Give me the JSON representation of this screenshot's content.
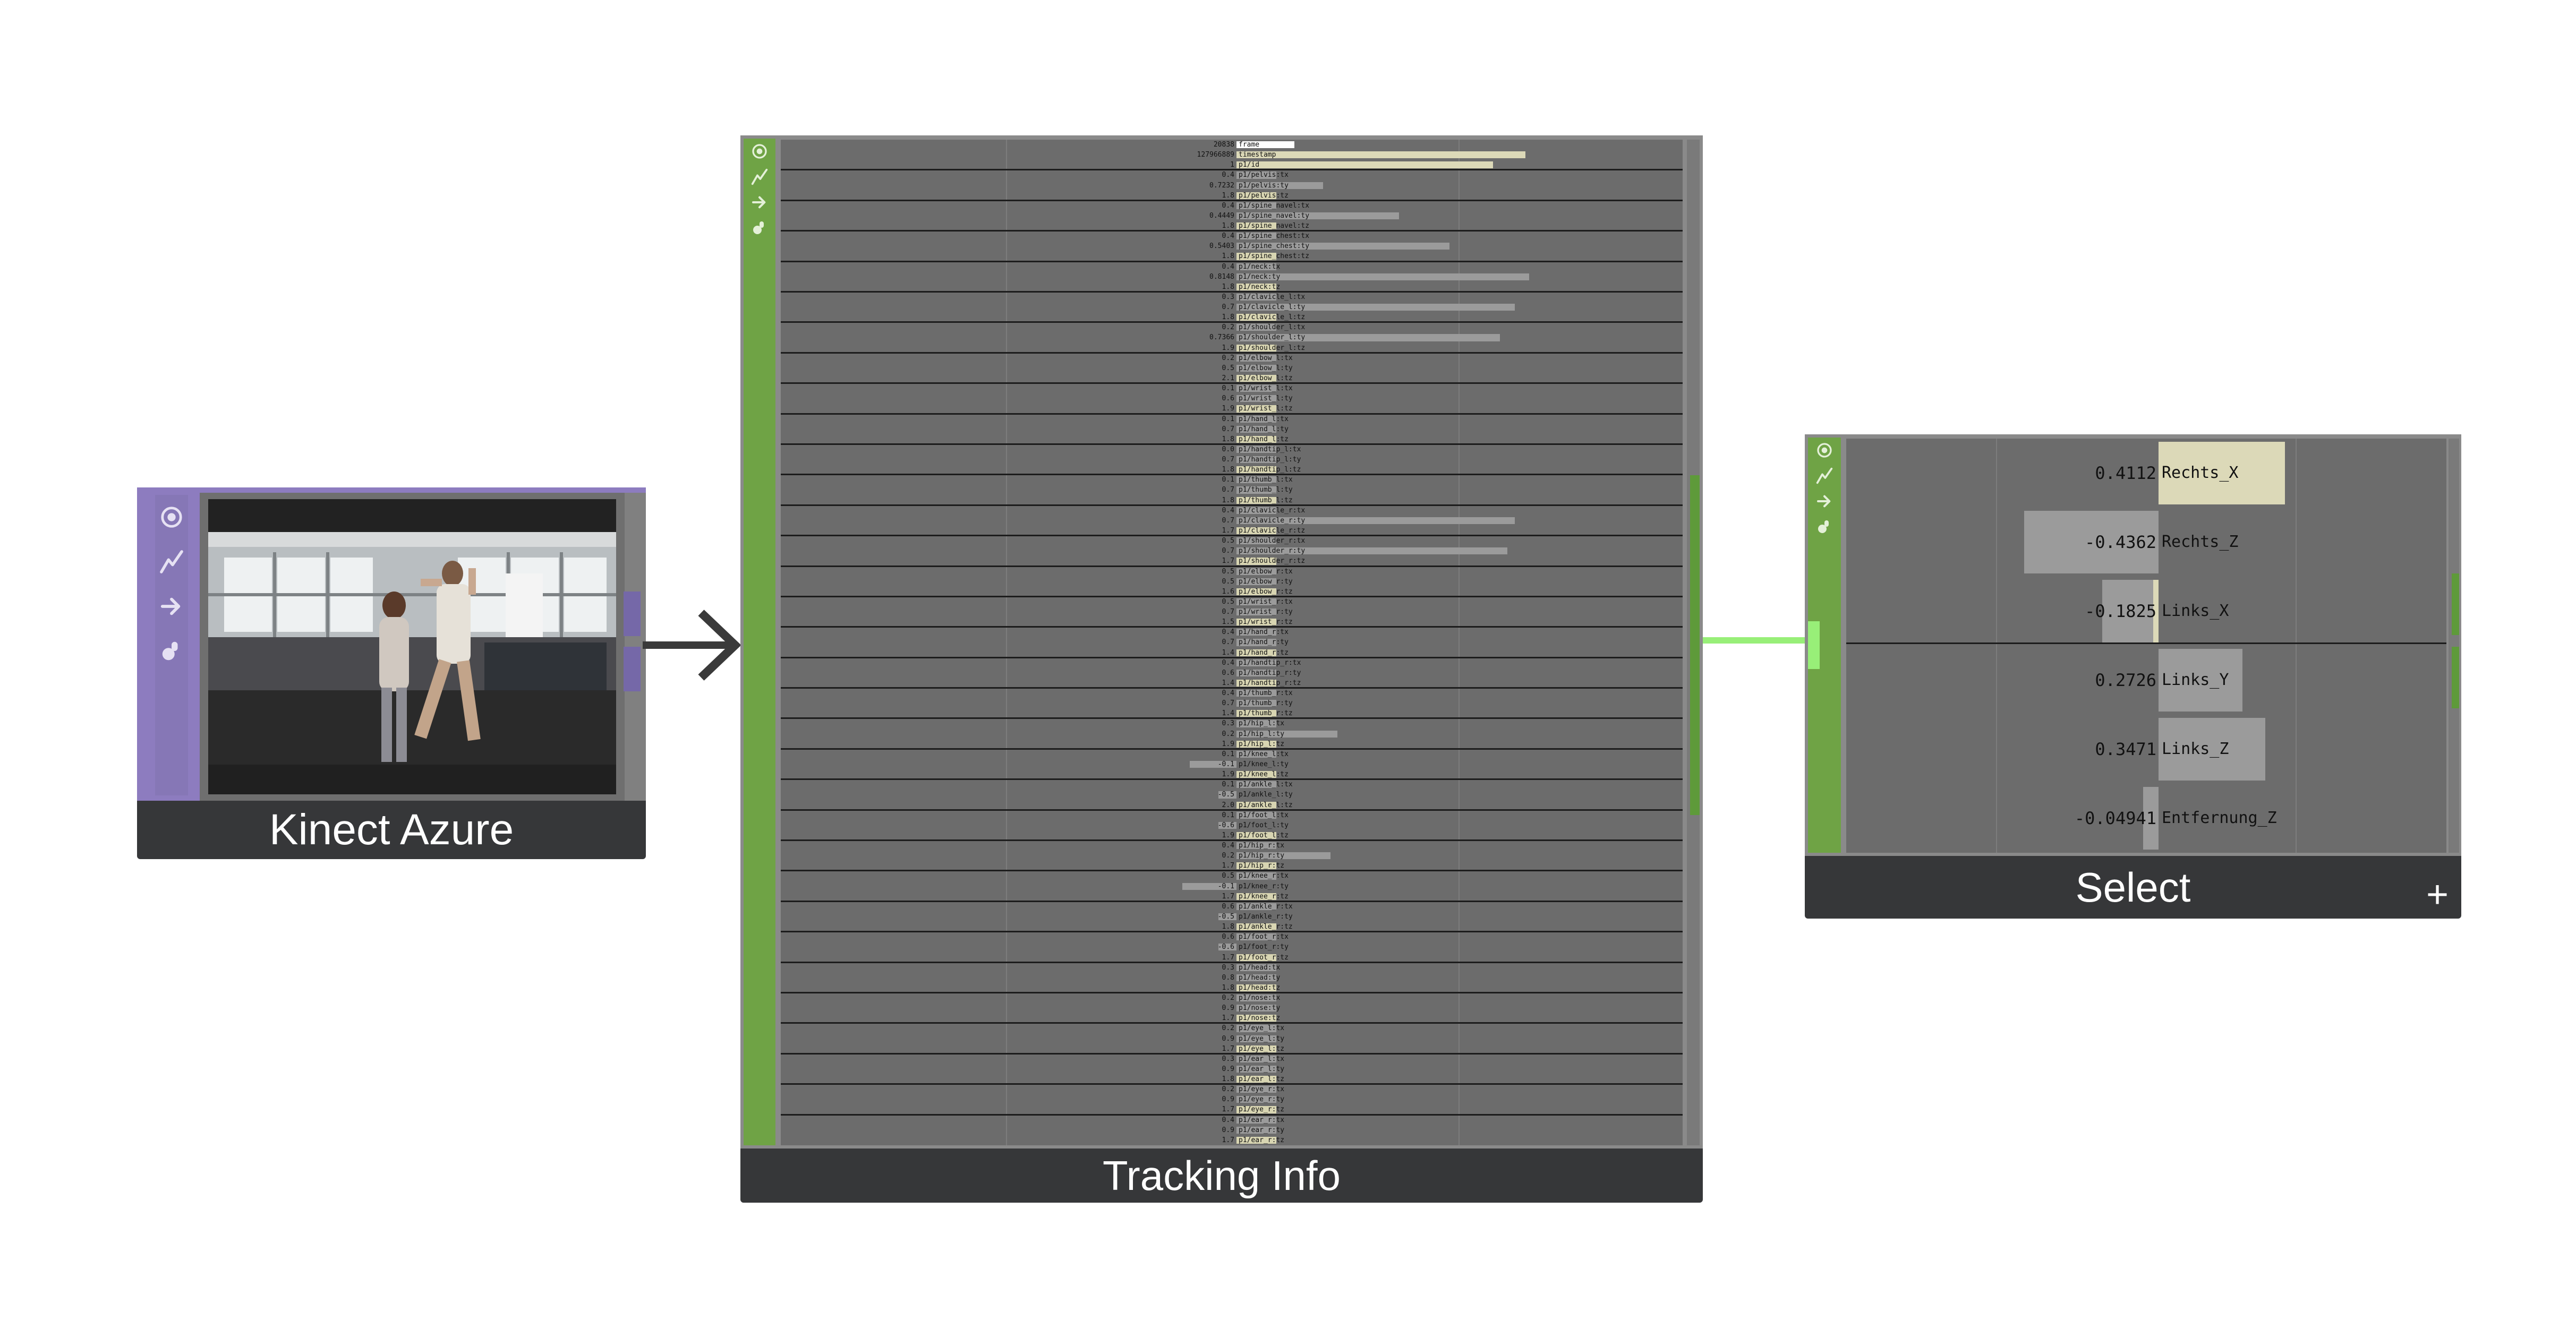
{
  "colors": {
    "purple_sidebar": "#8d7cbf",
    "green_sidebar": "#6fa345",
    "panel_gray": "#6c6c6c",
    "caption_bg": "#363739",
    "bar_light": "#dcd9b8",
    "bar_gray": "#9b9b9b",
    "connector_green": "#98ef78",
    "arrow": "#3a3a3a"
  },
  "icons": [
    "target-icon",
    "activity-icon",
    "arrow-right-icon",
    "grab-icon"
  ],
  "kinect": {
    "title": "Kinect Azure"
  },
  "tracking": {
    "title": "Tracking Info",
    "rows": [
      {
        "value": "20838",
        "label": "frame",
        "bar": 0.16
      },
      {
        "value": "127966889",
        "label": "timestamp",
        "bar": 0.8
      },
      {
        "value": "1",
        "label": "p1/id",
        "bar": 0.71
      },
      {
        "value": "0.4",
        "label": "p1/pelvis:tx",
        "bar": 0.11
      },
      {
        "value": "0.7232",
        "label": "p1/pelvis:ty",
        "bar": 0.24
      },
      {
        "value": "1.8",
        "label": "p1/pelvis:tz",
        "bar": 0.11
      },
      {
        "value": "0.4",
        "label": "p1/spine_navel:tx",
        "bar": 0.11
      },
      {
        "value": "0.4449",
        "label": "p1/spine_navel:ty",
        "bar": 0.45
      },
      {
        "value": "1.8",
        "label": "p1/spine_navel:tz",
        "bar": 0.11
      },
      {
        "value": "0.4",
        "label": "p1/spine_chest:tx",
        "bar": 0.11
      },
      {
        "value": "0.5403",
        "label": "p1/spine_chest:ty",
        "bar": 0.59
      },
      {
        "value": "1.8",
        "label": "p1/spine_chest:tz",
        "bar": 0.11
      },
      {
        "value": "0.4",
        "label": "p1/neck:tx",
        "bar": 0.11
      },
      {
        "value": "0.8148",
        "label": "p1/neck:ty",
        "bar": 0.81
      },
      {
        "value": "1.8",
        "label": "p1/neck:tz",
        "bar": 0.11
      },
      {
        "value": "0.3",
        "label": "p1/clavicle_l:tx",
        "bar": 0.11
      },
      {
        "value": "0.7",
        "label": "p1/clavicle_l:ty",
        "bar": 0.77
      },
      {
        "value": "1.8",
        "label": "p1/clavicle_l:tz",
        "bar": 0.11
      },
      {
        "value": "0.2",
        "label": "p1/shoulder_l:tx",
        "bar": 0.11
      },
      {
        "value": "0.7366",
        "label": "p1/shoulder_l:ty",
        "bar": 0.73
      },
      {
        "value": "1.9",
        "label": "p1/shoulder_l:tz",
        "bar": 0.11
      },
      {
        "value": "0.2",
        "label": "p1/elbow_l:tx",
        "bar": 0.11
      },
      {
        "value": "0.5",
        "label": "p1/elbow_l:ty",
        "bar": 0.11
      },
      {
        "value": "2.1",
        "label": "p1/elbow_l:tz",
        "bar": 0.11
      },
      {
        "value": "0.1",
        "label": "p1/wrist_l:tx",
        "bar": 0.11
      },
      {
        "value": "0.6",
        "label": "p1/wrist_l:ty",
        "bar": 0.11
      },
      {
        "value": "1.9",
        "label": "p1/wrist_l:tz",
        "bar": 0.11
      },
      {
        "value": "0.1",
        "label": "p1/hand_l:tx",
        "bar": 0.11
      },
      {
        "value": "0.7",
        "label": "p1/hand_l:ty",
        "bar": 0.11
      },
      {
        "value": "1.8",
        "label": "p1/hand_l:tz",
        "bar": 0.11
      },
      {
        "value": "0.0",
        "label": "p1/handtip_l:tx",
        "bar": 0.11
      },
      {
        "value": "0.7",
        "label": "p1/handtip_l:ty",
        "bar": 0.11
      },
      {
        "value": "1.8",
        "label": "p1/handtip_l:tz",
        "bar": 0.11
      },
      {
        "value": "0.1",
        "label": "p1/thumb_l:tx",
        "bar": 0.11
      },
      {
        "value": "0.7",
        "label": "p1/thumb_l:ty",
        "bar": 0.11
      },
      {
        "value": "1.8",
        "label": "p1/thumb_l:tz",
        "bar": 0.11
      },
      {
        "value": "0.4",
        "label": "p1/clavicle_r:tx",
        "bar": 0.11
      },
      {
        "value": "0.7",
        "label": "p1/clavicle_r:ty",
        "bar": 0.77
      },
      {
        "value": "1.7",
        "label": "p1/clavicle_r:tz",
        "bar": 0.11
      },
      {
        "value": "0.5",
        "label": "p1/shoulder_r:tx",
        "bar": 0.11
      },
      {
        "value": "0.7",
        "label": "p1/shoulder_r:ty",
        "bar": 0.75
      },
      {
        "value": "1.7",
        "label": "p1/shoulder_r:tz",
        "bar": 0.11
      },
      {
        "value": "0.5",
        "label": "p1/elbow_r:tx",
        "bar": 0.11
      },
      {
        "value": "0.5",
        "label": "p1/elbow_r:ty",
        "bar": 0.11
      },
      {
        "value": "1.6",
        "label": "p1/elbow_r:tz",
        "bar": 0.11
      },
      {
        "value": "0.5",
        "label": "p1/wrist_r:tx",
        "bar": 0.11
      },
      {
        "value": "0.7",
        "label": "p1/wrist_r:ty",
        "bar": 0.11
      },
      {
        "value": "1.5",
        "label": "p1/wrist_r:tz",
        "bar": 0.11
      },
      {
        "value": "0.4",
        "label": "p1/hand_r:tx",
        "bar": 0.11
      },
      {
        "value": "0.7",
        "label": "p1/hand_r:ty",
        "bar": 0.11
      },
      {
        "value": "1.4",
        "label": "p1/hand_r:tz",
        "bar": 0.11
      },
      {
        "value": "0.4",
        "label": "p1/handtip_r:tx",
        "bar": 0.11
      },
      {
        "value": "0.6",
        "label": "p1/handtip_r:ty",
        "bar": 0.11
      },
      {
        "value": "1.4",
        "label": "p1/handtip_r:tz",
        "bar": 0.11
      },
      {
        "value": "0.4",
        "label": "p1/thumb_r:tx",
        "bar": 0.11
      },
      {
        "value": "0.7",
        "label": "p1/thumb_r:ty",
        "bar": 0.11
      },
      {
        "value": "1.4",
        "label": "p1/thumb_r:tz",
        "bar": 0.11
      },
      {
        "value": "0.3",
        "label": "p1/hip_l:tx",
        "bar": 0.11
      },
      {
        "value": "0.2",
        "label": "p1/hip_l:ty",
        "bar": 0.28
      },
      {
        "value": "1.9",
        "label": "p1/hip_l:tz",
        "bar": 0.11
      },
      {
        "value": "0.1",
        "label": "p1/knee_l:tx",
        "bar": 0.11
      },
      {
        "value": "-0.1",
        "label": "p1/knee_l:ty",
        "bar": -0.13
      },
      {
        "value": "1.9",
        "label": "p1/knee_l:tz",
        "bar": 0.11
      },
      {
        "value": "0.1",
        "label": "p1/ankle_l:tx",
        "bar": 0.11
      },
      {
        "value": "-0.5",
        "label": "p1/ankle_l:ty",
        "bar": -0.05
      },
      {
        "value": "2.0",
        "label": "p1/ankle_l:tz",
        "bar": 0.11
      },
      {
        "value": "0.1",
        "label": "p1/foot_l:tx",
        "bar": 0.11
      },
      {
        "value": "-0.6",
        "label": "p1/foot_l:ty",
        "bar": -0.05
      },
      {
        "value": "1.9",
        "label": "p1/foot_l:tz",
        "bar": 0.11
      },
      {
        "value": "0.4",
        "label": "p1/hip_r:tx",
        "bar": 0.11
      },
      {
        "value": "0.2",
        "label": "p1/hip_r:ty",
        "bar": 0.26
      },
      {
        "value": "1.7",
        "label": "p1/hip_r:tz",
        "bar": 0.11
      },
      {
        "value": "0.5",
        "label": "p1/knee_r:tx",
        "bar": 0.11
      },
      {
        "value": "-0.1",
        "label": "p1/knee_r:ty",
        "bar": -0.15
      },
      {
        "value": "1.7",
        "label": "p1/knee_r:tz",
        "bar": 0.11
      },
      {
        "value": "0.6",
        "label": "p1/ankle_r:tx",
        "bar": 0.11
      },
      {
        "value": "-0.5",
        "label": "p1/ankle_r:ty",
        "bar": -0.05
      },
      {
        "value": "1.8",
        "label": "p1/ankle_r:tz",
        "bar": 0.11
      },
      {
        "value": "0.6",
        "label": "p1/foot_r:tx",
        "bar": 0.11
      },
      {
        "value": "-0.6",
        "label": "p1/foot_r:ty",
        "bar": -0.05
      },
      {
        "value": "1.7",
        "label": "p1/foot_r:tz",
        "bar": 0.11
      },
      {
        "value": "0.3",
        "label": "p1/head:tx",
        "bar": 0.11
      },
      {
        "value": "0.8",
        "label": "p1/head:ty",
        "bar": 0.11
      },
      {
        "value": "1.8",
        "label": "p1/head:tz",
        "bar": 0.11
      },
      {
        "value": "0.2",
        "label": "p1/nose:tx",
        "bar": 0.11
      },
      {
        "value": "0.9",
        "label": "p1/nose:ty",
        "bar": 0.11
      },
      {
        "value": "1.7",
        "label": "p1/nose:tz",
        "bar": 0.11
      },
      {
        "value": "0.2",
        "label": "p1/eye_l:tx",
        "bar": 0.11
      },
      {
        "value": "0.9",
        "label": "p1/eye_l:ty",
        "bar": 0.11
      },
      {
        "value": "1.7",
        "label": "p1/eye_l:tz",
        "bar": 0.11
      },
      {
        "value": "0.3",
        "label": "p1/ear_l:tx",
        "bar": 0.11
      },
      {
        "value": "0.9",
        "label": "p1/ear_l:ty",
        "bar": 0.11
      },
      {
        "value": "1.8",
        "label": "p1/ear_l:tz",
        "bar": 0.11
      },
      {
        "value": "0.2",
        "label": "p1/eye_r:tx",
        "bar": 0.11
      },
      {
        "value": "0.9",
        "label": "p1/eye_r:ty",
        "bar": 0.11
      },
      {
        "value": "1.7",
        "label": "p1/eye_r:tz",
        "bar": 0.11
      },
      {
        "value": "0.4",
        "label": "p1/ear_r:tx",
        "bar": 0.11
      },
      {
        "value": "0.9",
        "label": "p1/ear_r:ty",
        "bar": 0.11
      },
      {
        "value": "1.7",
        "label": "p1/ear_r:tz",
        "bar": 0.11
      }
    ]
  },
  "select": {
    "title": "Select",
    "add_label": "+",
    "rows": [
      {
        "value": "0.4112",
        "label": "Rechts_X",
        "bar": 0.4112
      },
      {
        "value": "-0.4362",
        "label": "Rechts_Z",
        "bar": -0.4362
      },
      {
        "value": "-0.1825",
        "label": "Links_X",
        "bar": -0.1825
      },
      {
        "value": "0.2726",
        "label": "Links_Y",
        "bar": 0.2726
      },
      {
        "value": "0.3471",
        "label": "Links_Z",
        "bar": 0.3471
      },
      {
        "value": "-0.04941",
        "label": "Entfernung_Z",
        "bar": -0.04941
      }
    ]
  }
}
